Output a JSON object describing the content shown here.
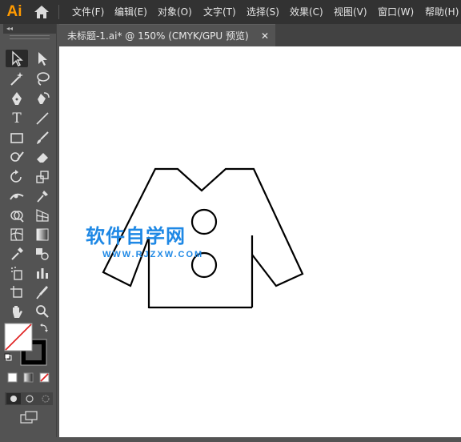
{
  "app": {
    "logo_text": "Ai"
  },
  "menu": {
    "items": [
      {
        "label": "文件(F)"
      },
      {
        "label": "编辑(E)"
      },
      {
        "label": "对象(O)"
      },
      {
        "label": "文字(T)"
      },
      {
        "label": "选择(S)"
      },
      {
        "label": "效果(C)"
      },
      {
        "label": "视图(V)"
      },
      {
        "label": "窗口(W)"
      },
      {
        "label": "帮助(H)"
      }
    ]
  },
  "toolbar": {
    "collapse_glyph": "◂◂",
    "tools": [
      {
        "icon": "selection-arrow-icon"
      },
      {
        "icon": "direct-selection-arrow-icon"
      },
      {
        "icon": "magic-wand-icon"
      },
      {
        "icon": "lasso-icon"
      },
      {
        "icon": "pen-icon"
      },
      {
        "icon": "curvature-icon"
      },
      {
        "icon": "type-icon",
        "glyph": "T"
      },
      {
        "icon": "line-segment-icon"
      },
      {
        "icon": "rectangle-icon"
      },
      {
        "icon": "paintbrush-icon"
      },
      {
        "icon": "shaper-icon"
      },
      {
        "icon": "eraser-icon"
      },
      {
        "icon": "rotate-icon"
      },
      {
        "icon": "scale-icon"
      },
      {
        "icon": "width-icon"
      },
      {
        "icon": "puppet-warp-icon"
      },
      {
        "icon": "shape-builder-icon"
      },
      {
        "icon": "perspective-grid-icon"
      },
      {
        "icon": "mesh-icon"
      },
      {
        "icon": "gradient-icon"
      },
      {
        "icon": "eyedropper-icon"
      },
      {
        "icon": "blend-icon"
      },
      {
        "icon": "symbol-sprayer-icon"
      },
      {
        "icon": "column-graph-icon"
      },
      {
        "icon": "artboard-icon"
      },
      {
        "icon": "slice-icon"
      },
      {
        "icon": "hand-icon"
      },
      {
        "icon": "zoom-icon"
      }
    ],
    "fill_stroke": {
      "fill": "none",
      "stroke": "#000000"
    }
  },
  "document": {
    "tab_label": "未标题-1.ai* @ 150% (CMYK/GPU 预览)",
    "close_glyph": "✕"
  },
  "watermark": {
    "title": "软件自学网",
    "url": "WWW.RJZXW.COM"
  },
  "colors": {
    "accent": "#FF9A00",
    "watermark": "#1e88e5"
  }
}
